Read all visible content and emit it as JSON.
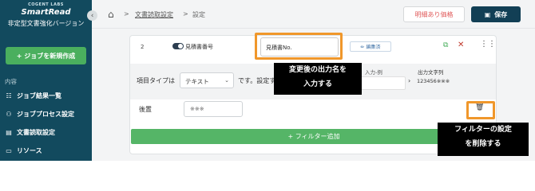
{
  "sidebar": {
    "brand_small": "COGENT LABS",
    "brand_main": "SmartRead",
    "brand_sub": "非定型文書強化バージョン",
    "new_job_label": "+ ジョブを新規作成",
    "section_label": "内容",
    "items": [
      {
        "label": "ジョブ結果一覧",
        "icon": "list-icon"
      },
      {
        "label": "ジョブプロセス設定",
        "icon": "flow-icon"
      },
      {
        "label": "文書読取設定",
        "icon": "document-icon"
      },
      {
        "label": "リソース",
        "icon": "folder-icon"
      }
    ]
  },
  "topbar": {
    "breadcrumb": [
      "文書読取設定",
      "設定"
    ],
    "price_button": "明細あり価格",
    "save_button": "保存"
  },
  "field": {
    "number": "2",
    "toggle_label": "見積書番号",
    "name_value": "見積書No.",
    "edit_done": "✏ 編集済",
    "type_label": "項目タイプは",
    "type_value": "テキスト",
    "type_suffix": "です。設定す",
    "example_label": "入力-例",
    "output_label": "出力文字列",
    "output_value": "123456※※※",
    "suffix_label": "後置",
    "suffix_value": "※※※",
    "add_filter": "+ フィルター追加"
  },
  "annotations": {
    "callout_rename": [
      "変更後の出力名を",
      "入力する"
    ],
    "callout_delete": [
      "フィルターの設定",
      "を削除する"
    ],
    "highlight_color": "#f0972b"
  }
}
